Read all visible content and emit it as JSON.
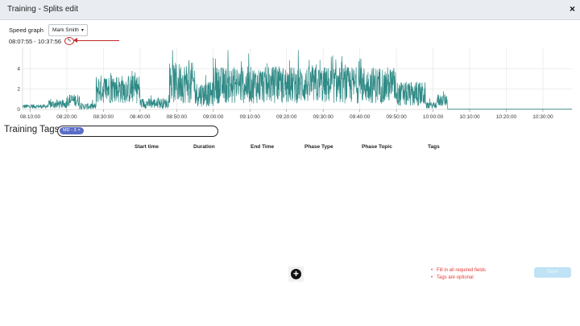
{
  "window": {
    "title": "Training - Splits edit",
    "close_glyph": "×"
  },
  "speed_graph": {
    "label": "Speed graph",
    "athlete": "Mark Smith",
    "time_range": "08:07:55 - 10:37:56"
  },
  "chart_data": {
    "type": "line",
    "x_ticks": [
      "08:10:00",
      "08:20:00",
      "08:30:00",
      "08:40:00",
      "08:50:00",
      "09:00:00",
      "09:10:00",
      "09:20:00",
      "09:30:00",
      "09:40:00",
      "09:50:00",
      "10:00:00",
      "10:10:00",
      "10:20:00",
      "10:30:00"
    ],
    "y_ticks": [
      0,
      2,
      4
    ],
    "ylim": [
      0,
      6
    ],
    "grid": true,
    "color": "#2f8a86",
    "series": [
      {
        "segments": [
          {
            "start": "08:07:55",
            "end": "08:15:00",
            "avg": 0.3,
            "amp": 0.2
          },
          {
            "start": "08:15:00",
            "end": "08:20:00",
            "avg": 0.5,
            "amp": 0.4
          },
          {
            "start": "08:20:00",
            "end": "08:23:30",
            "avg": 0.9,
            "amp": 0.6
          },
          {
            "start": "08:23:30",
            "end": "08:28:00",
            "avg": 0.3,
            "amp": 0.3
          },
          {
            "start": "08:28:00",
            "end": "08:40:00",
            "avg": 2.0,
            "amp": 1.4
          },
          {
            "start": "08:40:00",
            "end": "08:48:00",
            "avg": 0.6,
            "amp": 0.5
          },
          {
            "start": "08:48:00",
            "end": "08:55:00",
            "avg": 2.6,
            "amp": 2.0
          },
          {
            "start": "08:55:00",
            "end": "09:00:00",
            "avg": 1.5,
            "amp": 1.2
          },
          {
            "start": "09:00:00",
            "end": "09:50:00",
            "avg": 2.4,
            "amp": 1.8
          },
          {
            "start": "09:50:00",
            "end": "09:58:00",
            "avg": 1.5,
            "amp": 1.2
          },
          {
            "start": "09:58:00",
            "end": "10:01:00",
            "avg": 0.4,
            "amp": 0.3
          },
          {
            "start": "10:01:00",
            "end": "10:04:00",
            "avg": 0.9,
            "amp": 0.6
          },
          {
            "start": "10:04:00",
            "end": "10:37:56",
            "avg": 0.05,
            "amp": 0.0
          }
        ]
      }
    ]
  },
  "tags": {
    "title": "Training Tags",
    "chips": [
      "MD - 3"
    ],
    "remove_glyph": "×"
  },
  "table": {
    "columns": [
      "Start time",
      "Duration",
      "End Time",
      "Phase Type",
      "Phase Topic",
      "Tags"
    ]
  },
  "actions": {
    "add_glyph": "+",
    "save_label": "Save"
  },
  "validation": {
    "messages": [
      "Fill in all required fields",
      "Tags are optional"
    ]
  },
  "colors": {
    "accent": "#2f8a86",
    "error": "#e53935",
    "chip": "#5b6cc6",
    "save_disabled": "#bfe3f5"
  }
}
